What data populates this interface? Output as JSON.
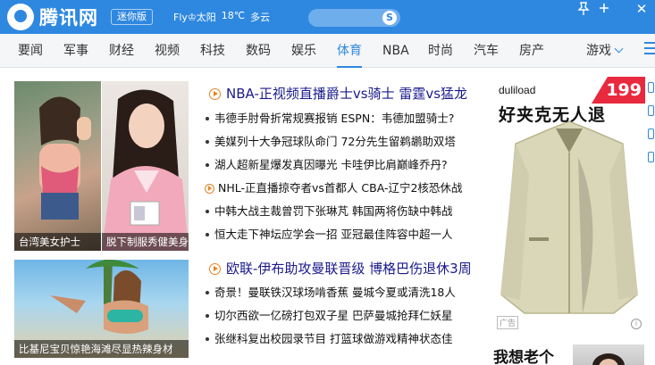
{
  "header": {
    "brand": "腾讯网",
    "mini_badge": "迷你版",
    "weather_city": "Fly♔太阳",
    "weather_temp": "18℃",
    "weather_desc": "多云",
    "search_placeholder": "",
    "search_icon_glyph": "S",
    "pin_icon": "pin-icon",
    "close_glyph": "✕"
  },
  "nav": {
    "items": [
      "要闻",
      "军事",
      "财经",
      "视频",
      "科技",
      "数码",
      "娱乐",
      "体育",
      "NBA",
      "时尚",
      "汽车",
      "房产"
    ],
    "active": "体育",
    "more_label": "游戏"
  },
  "photos": [
    {
      "caption": "台湾美女护士"
    },
    {
      "caption": "脱下制服秀健美身材"
    },
    {
      "caption": "比基尼宝贝惊艳海滩尽显热辣身材"
    }
  ],
  "section1": {
    "headline": "NBA-正视频直播爵士vs骑士 雷霆vs猛龙",
    "items": [
      {
        "text": "韦德手肘骨折常规赛报销 ESPN：韦德加盟骑士?",
        "icon": "bullet"
      },
      {
        "text": "美媒列十大争冠球队命门 72分先生留鹈鹕助双塔",
        "icon": "bullet"
      },
      {
        "text": "湖人超新星爆发真因曝光 卡哇伊比肩巅峰乔丹?",
        "icon": "bullet"
      },
      {
        "text": "NHL-正直播掠夺者vs首都人 CBA-辽宁2核恐休战",
        "icon": "play-icon"
      },
      {
        "text": "中韩大战主裁曾罚下张琳芃 韩国两将伤缺中韩战",
        "icon": "bullet"
      },
      {
        "text": "恒大走下神坛应学会一招 亚冠最佳阵容中超一人",
        "icon": "bullet"
      }
    ]
  },
  "section2": {
    "headline": "欧联-伊布助攻曼联晋级 博格巴伤退休3周",
    "items": [
      {
        "text": "奇景！曼联铁汉球场啃香蕉 曼城今夏或清洗18人",
        "icon": "bullet"
      },
      {
        "text": "切尔西欲一亿磅打包双子星 巴萨曼城抢拜仁妖星",
        "icon": "bullet"
      },
      {
        "text": "张继科复出校园录节目 打篮球做游戏精神状态佳",
        "icon": "bullet"
      }
    ]
  },
  "ad": {
    "brand": "duliload",
    "slogan": "好夹克无人退",
    "price": "199",
    "tag": "广告",
    "info_glyph": "i"
  },
  "teaser": {
    "text": "我想老个"
  },
  "colors": {
    "brand_blue": "#2f88e0",
    "orange_accent": "#e6821e",
    "headline_blue": "#1a1a8c",
    "price_red": "#e8293e"
  }
}
